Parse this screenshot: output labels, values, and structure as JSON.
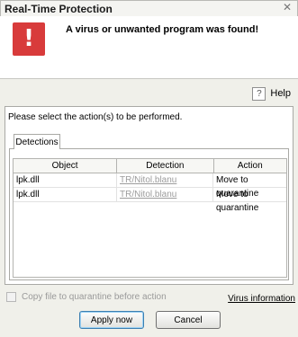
{
  "window": {
    "title": "Real-Time Protection",
    "close_glyph": "✕"
  },
  "header": {
    "alert_glyph": "!",
    "message": "A virus or unwanted program was found!",
    "alert_color": "#d83b3b"
  },
  "help": {
    "icon_glyph": "?",
    "label": "Help"
  },
  "panel": {
    "instruction": "Please select the action(s) to be performed.",
    "tab_label": "Detections",
    "columns": [
      "Object",
      "Detection",
      "Action"
    ],
    "rows": [
      {
        "object": "lpk.dll",
        "detection": "TR/Nitol.blanu",
        "action": "Move to quarantine"
      },
      {
        "object": "lpk.dll",
        "detection": "TR/Nitol.blanu",
        "action": "Move to quarantine"
      }
    ]
  },
  "options": {
    "copy_to_quarantine_label": "Copy file to quarantine before action",
    "copy_to_quarantine_checked": false,
    "virus_info_link": "Virus information"
  },
  "buttons": {
    "apply": "Apply now",
    "cancel": "Cancel"
  }
}
